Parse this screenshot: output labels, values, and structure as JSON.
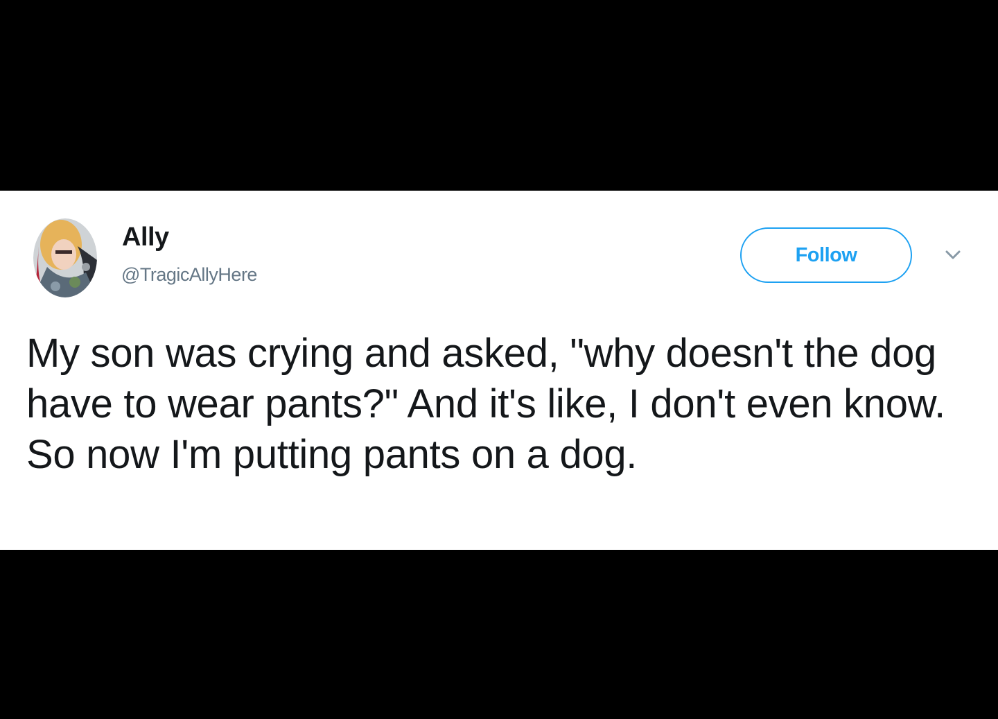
{
  "tweet": {
    "author": {
      "display_name": "Ally",
      "handle": "@TragicAllyHere",
      "avatar_icon": "user-avatar-photo"
    },
    "follow_button": {
      "label": "Follow",
      "accent_color": "#1da1f2"
    },
    "menu_icon": "chevron-down-icon",
    "text": "My son was crying and asked, \"why doesn't the dog have to wear pants?\" And it's like, I don't even know. So now I'm putting pants on a dog."
  },
  "colors": {
    "frame_background": "#000000",
    "card_background": "#ffffff",
    "text_primary": "#14171a",
    "text_secondary": "#657786"
  }
}
